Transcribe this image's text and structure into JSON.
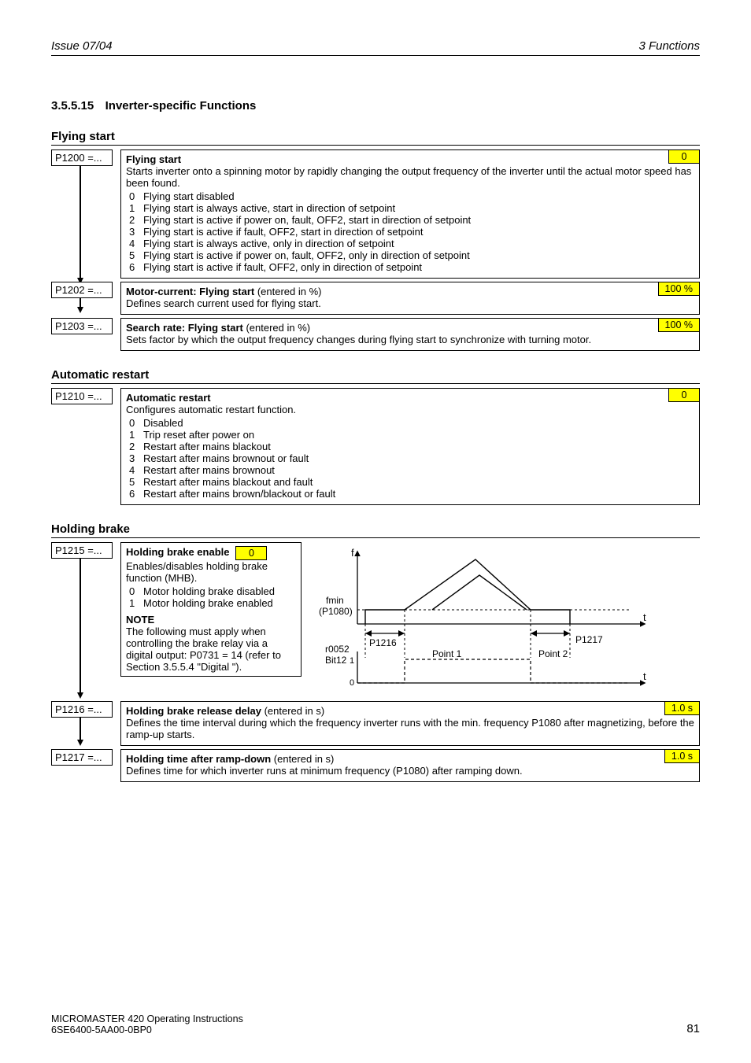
{
  "header": {
    "left": "Issue 07/04",
    "right": "3  Functions"
  },
  "section": {
    "num": "3.5.5.15",
    "title": "Inverter-specific Functions"
  },
  "flying": {
    "heading": "Flying start",
    "p1200": {
      "param": "P1200 =...",
      "title": "Flying start",
      "badge": "0",
      "desc": "Starts inverter onto a spinning motor by rapidly changing the output frequency of the inverter until the actual motor speed has been found.",
      "items": [
        "Flying start disabled",
        "Flying start is always active, start in direction of setpoint",
        "Flying start is active if power on, fault, OFF2, start in direction of setpoint",
        "Flying start is active if fault, OFF2, start in direction of setpoint",
        "Flying start is always active, only in direction of setpoint",
        "Flying start is active if power on, fault, OFF2, only in direction of setpoint",
        "Flying start is active if fault, OFF2, only in direction of setpoint"
      ]
    },
    "p1202": {
      "param": "P1202 =...",
      "title": "Motor-current: Flying start",
      "title_extra": " (entered in %)",
      "badge": "100 %",
      "desc": "Defines search current used for flying start."
    },
    "p1203": {
      "param": "P1203 =...",
      "title": "Search rate: Flying start",
      "title_extra": " (entered in %)",
      "badge": "100 %",
      "desc": "Sets factor by which the output frequency changes during flying start to synchronize with turning motor."
    }
  },
  "auto": {
    "heading": "Automatic restart",
    "p1210": {
      "param": "P1210 =...",
      "title": "Automatic restart",
      "badge": "0",
      "desc": "Configures automatic restart function.",
      "items": [
        "Disabled",
        "Trip reset after power on",
        "Restart after mains blackout",
        "Restart after mains brownout or fault",
        "Restart after mains brownout",
        "Restart after mains blackout and fault",
        "Restart after mains brown/blackout or fault"
      ]
    }
  },
  "brake": {
    "heading": "Holding brake",
    "p1215": {
      "param": "P1215 =...",
      "title": "Holding brake enable",
      "badge": "0",
      "desc": "Enables/disables holding brake function (MHB).",
      "items": [
        "Motor holding brake disabled",
        "Motor holding brake enabled"
      ],
      "note_title": "NOTE",
      "note": "The following must apply when controlling the brake relay via a digital output: P0731 = 14 (refer to Section 3.5.5.4 \"Digital \")."
    },
    "diagram": {
      "f": "f",
      "t1": "t",
      "t2": "t",
      "fmin": "fmin",
      "p1080": "(P1080)",
      "p1216": "P1216",
      "p1217": "P1217",
      "r0052": "r0052",
      "bit12": "Bit12",
      "point1": "Point 1",
      "point2": "Point 2",
      "one": "1",
      "zero": "0"
    },
    "p1216": {
      "param": "P1216 =...",
      "title": "Holding brake release delay",
      "title_extra": " (entered in s)",
      "badge": "1.0 s",
      "desc": "Defines the time interval during which the frequency inverter runs with the min. frequency P1080 after magnetizing, before the ramp-up starts."
    },
    "p1217": {
      "param": "P1217 =...",
      "title": "Holding time after ramp-down",
      "title_extra": " (entered in s)",
      "badge": "1.0 s",
      "desc": "Defines time for which inverter runs at minimum frequency (P1080) after ramping down."
    }
  },
  "footer": {
    "l1": "MICROMASTER 420    Operating Instructions",
    "l2": "6SE6400-5AA00-0BP0",
    "page": "81"
  }
}
